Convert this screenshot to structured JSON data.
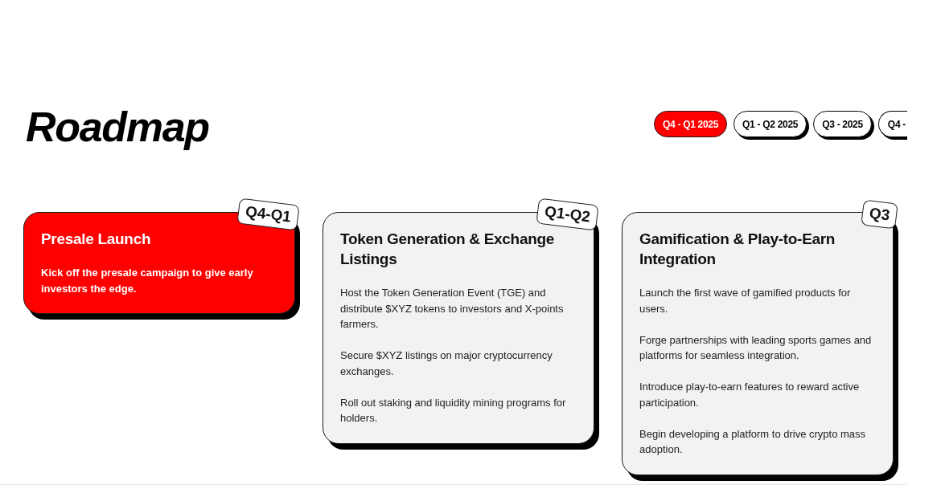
{
  "title": "Roadmap",
  "tabs": [
    {
      "label": "Q4 - Q1 2025",
      "selected": true
    },
    {
      "label": "Q1 - Q2 2025",
      "selected": false
    },
    {
      "label": "Q3 - 2025",
      "selected": false
    },
    {
      "label": "Q4 -",
      "selected": false
    }
  ],
  "cards": [
    {
      "badge": "Q4-Q1",
      "title": "Presale Launch",
      "selected": true,
      "items": [
        "Kick off the presale campaign to give early investors the edge."
      ]
    },
    {
      "badge": "Q1-Q2",
      "title": "Token Generation & Exchange Listings",
      "selected": false,
      "items": [
        "Host the Token Generation Event (TGE) and distribute $XYZ tokens to investors and X-points farmers.",
        "Secure $XYZ listings on major cryptocurrency exchanges.",
        "Roll out staking and liquidity mining programs for holders."
      ]
    },
    {
      "badge": "Q3",
      "title": "Gamification & Play-to-Earn Integration",
      "selected": false,
      "items": [
        "Launch the first wave of gamified products for users.",
        "Forge partnerships with leading sports games and platforms for seamless integration.",
        "Introduce play-to-earn features to reward active participation.",
        "Begin developing a platform to drive crypto mass adoption."
      ]
    }
  ]
}
